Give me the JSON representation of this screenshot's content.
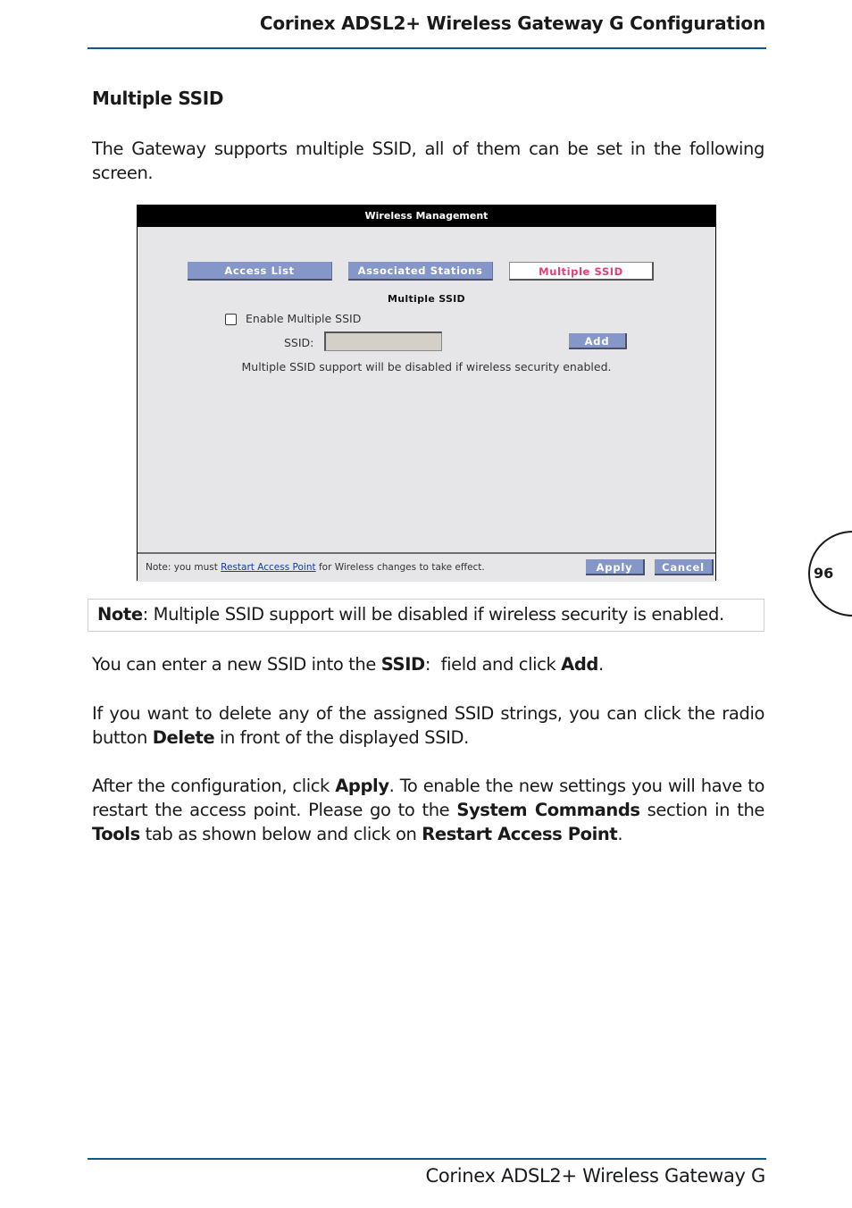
{
  "header": {
    "title": "Corinex ADSL2+ Wireless Gateway G Configuration"
  },
  "section_title": "Multiple SSID",
  "intro": "The Gateway supports multiple SSID, all of them can be set in the following screen.",
  "screenshot": {
    "window_title": "Wireless Management",
    "tabs": [
      {
        "label": "Access List",
        "active": false
      },
      {
        "label": "Associated Stations",
        "active": false
      },
      {
        "label": "Multiple SSID",
        "active": true
      }
    ],
    "panel_title": "Multiple SSID",
    "enable_checkbox": {
      "label": "Enable Multiple SSID",
      "checked": false
    },
    "ssid_field": {
      "label": "SSID:",
      "value": ""
    },
    "add_button": "Add",
    "warning": "Multiple SSID support will be disabled if wireless security enabled.",
    "footer": {
      "note_prefix": "Note: you must ",
      "note_link": "Restart Access Point",
      "note_suffix": " for Wireless changes to take effect.",
      "apply_button": "Apply",
      "cancel_button": "Cancel"
    },
    "colors": {
      "tab_inactive": "#8596c8",
      "tab_active_text": "#e0407a",
      "titlebar": "#000000"
    }
  },
  "note_box": {
    "label": "Note",
    "text": ": Multiple SSID support will be disabled if wireless security is enabled."
  },
  "paragraphs": {
    "p1": {
      "a": "You can enter a new SSID into the ",
      "b1": "SSID",
      "c": ":  field and click ",
      "b2": "Add",
      "d": "."
    },
    "p2": {
      "a": "If you want to delete any of the assigned SSID strings, you can click the radio button ",
      "b1": "Delete",
      "c": " in front of the displayed SSID."
    },
    "p3": {
      "a": "After the configuration, click ",
      "b1": "Apply",
      "c": ". To enable the new settings you will have to restart the access point. Please go to the ",
      "b2": "System Commands",
      "d": " section in the ",
      "b3": "Tools",
      "e": " tab as shown below and click on ",
      "b4": "Restart Access Point",
      "f": "."
    }
  },
  "page_number": "96",
  "footer": {
    "title": "Corinex ADSL2+ Wireless Gateway G"
  },
  "colors": {
    "rule": "#0e5a86"
  }
}
